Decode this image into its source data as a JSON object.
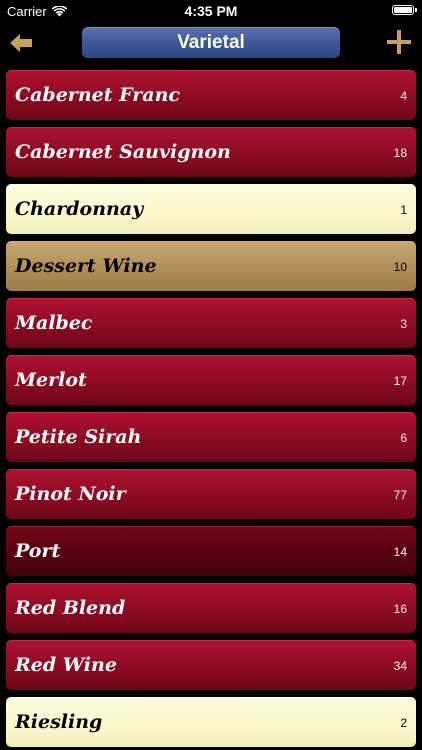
{
  "status_bar": {
    "carrier": "Carrier",
    "time": "4:35 PM",
    "wifi_icon": "wifi-icon",
    "battery_icon": "battery-icon"
  },
  "nav": {
    "title": "Varietal",
    "back_icon": "back-arrow-icon",
    "add_icon": "plus-icon",
    "accent_color": "#c8a252"
  },
  "varietals": [
    {
      "name": "Cabernet Franc",
      "count": "4",
      "style": "red"
    },
    {
      "name": "Cabernet Sauvignon",
      "count": "18",
      "style": "red"
    },
    {
      "name": "Chardonnay",
      "count": "1",
      "style": "white"
    },
    {
      "name": "Dessert Wine",
      "count": "10",
      "style": "dessert"
    },
    {
      "name": "Malbec",
      "count": "3",
      "style": "red"
    },
    {
      "name": "Merlot",
      "count": "17",
      "style": "red"
    },
    {
      "name": "Petite Sirah",
      "count": "6",
      "style": "red"
    },
    {
      "name": "Pinot Noir",
      "count": "77",
      "style": "red"
    },
    {
      "name": "Port",
      "count": "14",
      "style": "port"
    },
    {
      "name": "Red Blend",
      "count": "16",
      "style": "red"
    },
    {
      "name": "Red Wine",
      "count": "34",
      "style": "red"
    },
    {
      "name": "Riesling",
      "count": "2",
      "style": "white"
    }
  ]
}
